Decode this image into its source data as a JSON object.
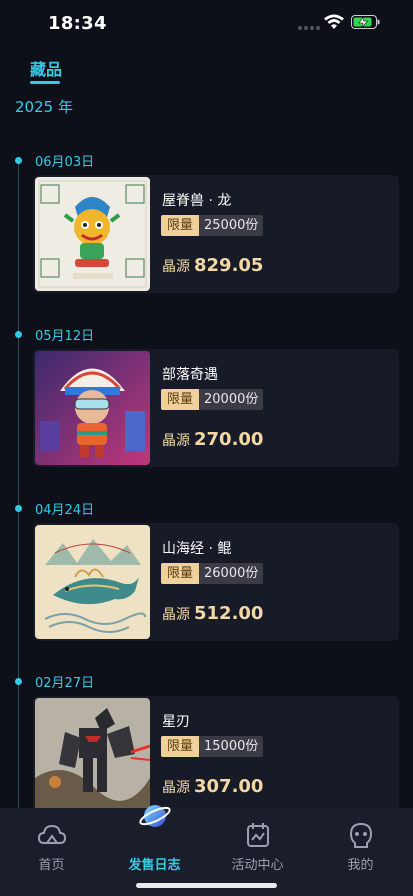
{
  "status_bar": {
    "time": "18:34"
  },
  "tabs": {
    "active": "藏品"
  },
  "year_label": "2025 年",
  "items": [
    {
      "date": "06月03日",
      "name": "屋脊兽 · 龙",
      "limit_tag": "限量",
      "limit_count": "25000份",
      "price_label": "晶源",
      "price": "829.05",
      "image": "dragon-roof-beast-image"
    },
    {
      "date": "05月12日",
      "name": "部落奇遇",
      "limit_tag": "限量",
      "limit_count": "20000份",
      "price_label": "晶源",
      "price": "270.00",
      "image": "tribal-character-image"
    },
    {
      "date": "04月24日",
      "name": "山海经 · 鲲",
      "limit_tag": "限量",
      "limit_count": "26000份",
      "price_label": "晶源",
      "price": "512.00",
      "image": "kun-whale-image"
    },
    {
      "date": "02月27日",
      "name": "星刃",
      "limit_tag": "限量",
      "limit_count": "15000份",
      "price_label": "晶源",
      "price": "307.00",
      "image": "mecha-robot-image"
    }
  ],
  "nav": [
    {
      "label": "首页",
      "icon": "cloud-home-icon",
      "active": false
    },
    {
      "label": "发售日志",
      "icon": "planet-icon",
      "active": true
    },
    {
      "label": "活动中心",
      "icon": "calendar-icon",
      "active": false
    },
    {
      "label": "我的",
      "icon": "profile-face-icon",
      "active": false
    }
  ],
  "colors": {
    "accent": "#35c9e6",
    "background": "#0e1019",
    "card": "#171a27",
    "price": "#f3d8a6",
    "tag": "#f0d19a"
  }
}
